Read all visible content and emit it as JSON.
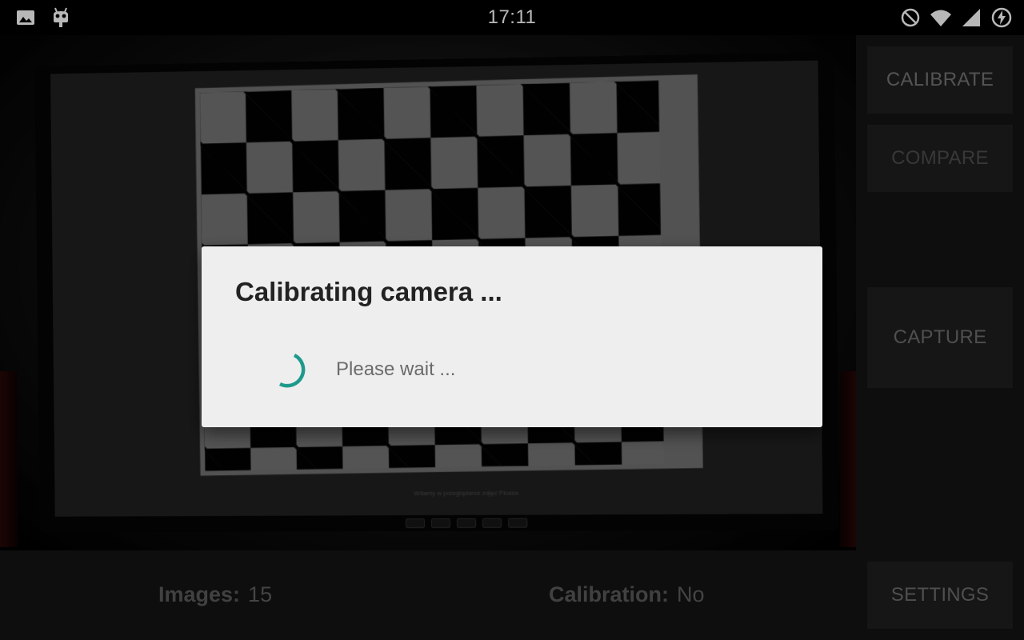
{
  "status_bar": {
    "time": "17:11",
    "left_icons": [
      "image-icon",
      "android-robot-icon"
    ],
    "right_icons": [
      "do-not-disturb-icon",
      "wifi-icon",
      "cell-signal-icon",
      "battery-charging-icon"
    ]
  },
  "side_panel": {
    "calibrate_label": "CALIBRATE",
    "compare_label": "COMPARE",
    "capture_label": "CAPTURE",
    "settings_label": "SETTINGS"
  },
  "bottom_bar": {
    "images_label": "Images:",
    "images_value": "15",
    "calibration_label": "Calibration:",
    "calibration_value": "No"
  },
  "preview": {
    "screen_caption": "Witamy w przeglądarce zdjęć Picasa"
  },
  "dialog": {
    "title": "Calibrating camera ...",
    "message": "Please wait ...",
    "spinner_color": "#1e9a8c"
  },
  "colors": {
    "panel_background": "#141414",
    "button_background": "#1f1f1f",
    "dialog_background": "#eeeeee",
    "accent": "#1e9a8c"
  }
}
